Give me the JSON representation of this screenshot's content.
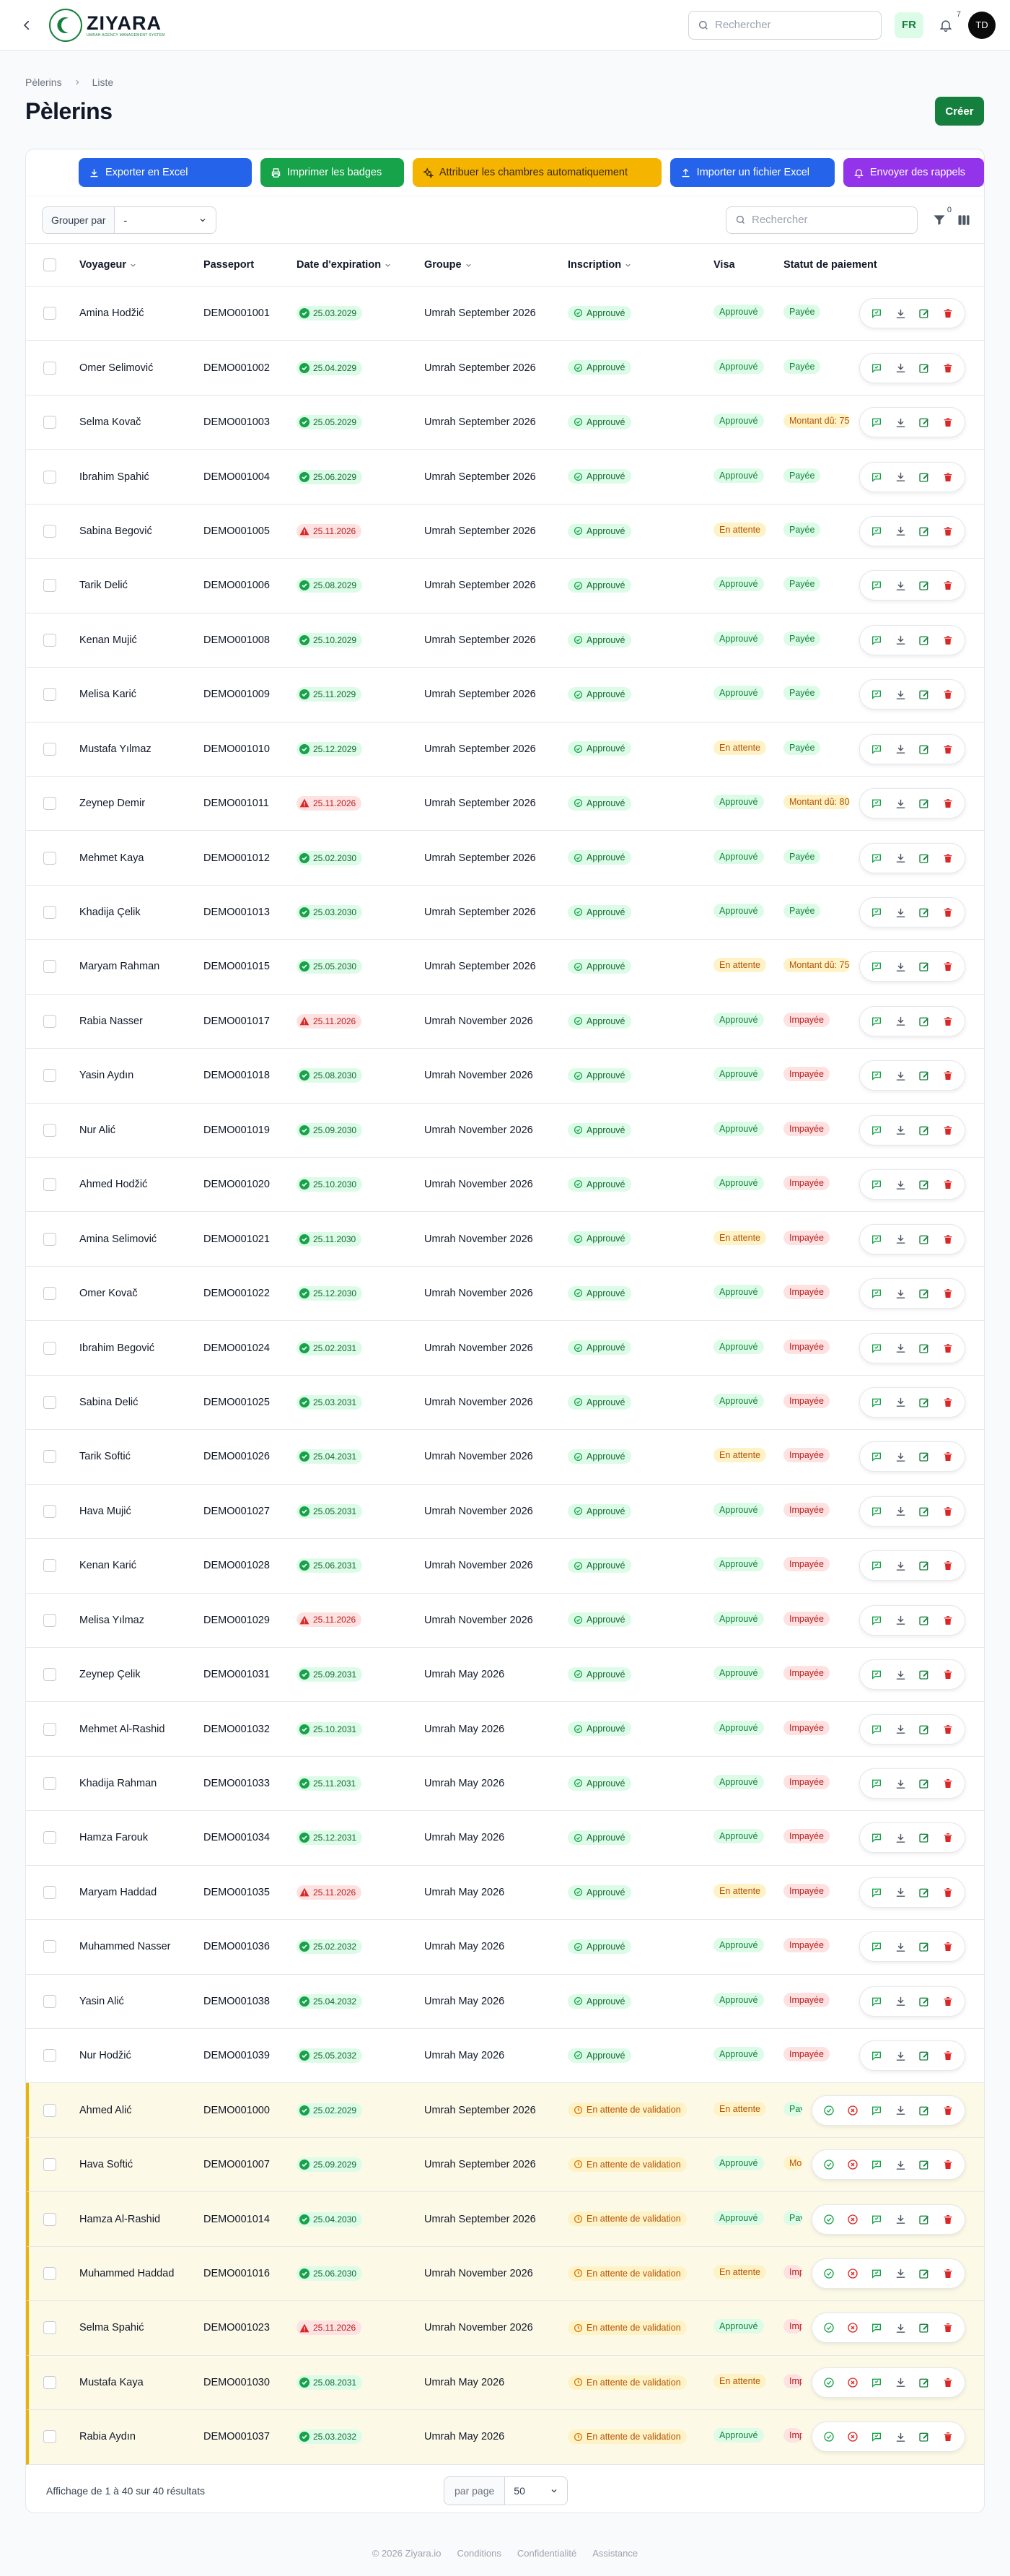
{
  "header": {
    "brand": "ZIYARA",
    "brand_sub": "UMRAH AGENCY MANAGEMENT SYSTEM",
    "search_placeholder": "Rechercher",
    "lang": "FR",
    "notifications": "7",
    "avatar": "TD"
  },
  "breadcrumb": {
    "home": "Pèlerins",
    "current": "Liste"
  },
  "page": {
    "title": "Pèlerins",
    "create_label": "Créer"
  },
  "actions": {
    "export": "Exporter en Excel",
    "print": "Imprimer les badges",
    "rooms": "Attribuer les chambres automatiquement",
    "import": "Importer un fichier Excel",
    "reminders": "Envoyer des rappels"
  },
  "filters": {
    "group_by_label": "Grouper par",
    "group_by_value": "-",
    "search_placeholder": "Rechercher",
    "filter_count": "0"
  },
  "columns": {
    "voyageur": "Voyageur",
    "passeport": "Passeport",
    "expiration": "Date d'expiration",
    "groupe": "Groupe",
    "inscription": "Inscription",
    "visa": "Visa",
    "paiement": "Statut de paiement"
  },
  "colors": {
    "brand": "#15803d",
    "pending_border": "#eab308"
  },
  "rows": [
    {
      "name": "Amina Hodžić",
      "passport": "DEMO001001",
      "exp": "25.03.2029",
      "exp_ok": true,
      "group": "Umrah September 2026",
      "ins": "Approuvé",
      "ins_ok": true,
      "visa": "Approuvé",
      "visa_ok": true,
      "pay": "Payée",
      "pay_type": "ok"
    },
    {
      "name": "Omer Selimović",
      "passport": "DEMO001002",
      "exp": "25.04.2029",
      "exp_ok": true,
      "group": "Umrah September 2026",
      "ins": "Approuvé",
      "ins_ok": true,
      "visa": "Approuvé",
      "visa_ok": true,
      "pay": "Payée",
      "pay_type": "ok"
    },
    {
      "name": "Selma Kovač",
      "passport": "DEMO001003",
      "exp": "25.05.2029",
      "exp_ok": true,
      "group": "Umrah September 2026",
      "ins": "Approuvé",
      "ins_ok": true,
      "visa": "Approuvé",
      "visa_ok": true,
      "pay": "Montant dû: 75",
      "pay_type": "due"
    },
    {
      "name": "Ibrahim Spahić",
      "passport": "DEMO001004",
      "exp": "25.06.2029",
      "exp_ok": true,
      "group": "Umrah September 2026",
      "ins": "Approuvé",
      "ins_ok": true,
      "visa": "Approuvé",
      "visa_ok": true,
      "pay": "Payée",
      "pay_type": "ok"
    },
    {
      "name": "Sabina Begović",
      "passport": "DEMO001005",
      "exp": "25.11.2026",
      "exp_ok": false,
      "group": "Umrah September 2026",
      "ins": "Approuvé",
      "ins_ok": true,
      "visa": "En attente",
      "visa_ok": false,
      "pay": "Payée",
      "pay_type": "ok"
    },
    {
      "name": "Tarik Delić",
      "passport": "DEMO001006",
      "exp": "25.08.2029",
      "exp_ok": true,
      "group": "Umrah September 2026",
      "ins": "Approuvé",
      "ins_ok": true,
      "visa": "Approuvé",
      "visa_ok": true,
      "pay": "Payée",
      "pay_type": "ok"
    },
    {
      "name": "Kenan Mujić",
      "passport": "DEMO001008",
      "exp": "25.10.2029",
      "exp_ok": true,
      "group": "Umrah September 2026",
      "ins": "Approuvé",
      "ins_ok": true,
      "visa": "Approuvé",
      "visa_ok": true,
      "pay": "Payée",
      "pay_type": "ok"
    },
    {
      "name": "Melisa Karić",
      "passport": "DEMO001009",
      "exp": "25.11.2029",
      "exp_ok": true,
      "group": "Umrah September 2026",
      "ins": "Approuvé",
      "ins_ok": true,
      "visa": "Approuvé",
      "visa_ok": true,
      "pay": "Payée",
      "pay_type": "ok"
    },
    {
      "name": "Mustafa Yılmaz",
      "passport": "DEMO001010",
      "exp": "25.12.2029",
      "exp_ok": true,
      "group": "Umrah September 2026",
      "ins": "Approuvé",
      "ins_ok": true,
      "visa": "En attente",
      "visa_ok": false,
      "pay": "Payée",
      "pay_type": "ok"
    },
    {
      "name": "Zeynep Demir",
      "passport": "DEMO001011",
      "exp": "25.11.2026",
      "exp_ok": false,
      "group": "Umrah September 2026",
      "ins": "Approuvé",
      "ins_ok": true,
      "visa": "Approuvé",
      "visa_ok": true,
      "pay": "Montant dû: 80",
      "pay_type": "due"
    },
    {
      "name": "Mehmet Kaya",
      "passport": "DEMO001012",
      "exp": "25.02.2030",
      "exp_ok": true,
      "group": "Umrah September 2026",
      "ins": "Approuvé",
      "ins_ok": true,
      "visa": "Approuvé",
      "visa_ok": true,
      "pay": "Payée",
      "pay_type": "ok"
    },
    {
      "name": "Khadija Çelik",
      "passport": "DEMO001013",
      "exp": "25.03.2030",
      "exp_ok": true,
      "group": "Umrah September 2026",
      "ins": "Approuvé",
      "ins_ok": true,
      "visa": "Approuvé",
      "visa_ok": true,
      "pay": "Payée",
      "pay_type": "ok"
    },
    {
      "name": "Maryam Rahman",
      "passport": "DEMO001015",
      "exp": "25.05.2030",
      "exp_ok": true,
      "group": "Umrah September 2026",
      "ins": "Approuvé",
      "ins_ok": true,
      "visa": "En attente",
      "visa_ok": false,
      "pay": "Montant dû: 75",
      "pay_type": "due"
    },
    {
      "name": "Rabia Nasser",
      "passport": "DEMO001017",
      "exp": "25.11.2026",
      "exp_ok": false,
      "group": "Umrah November 2026",
      "ins": "Approuvé",
      "ins_ok": true,
      "visa": "Approuvé",
      "visa_ok": true,
      "pay": "Impayée",
      "pay_type": "un"
    },
    {
      "name": "Yasin Aydın",
      "passport": "DEMO001018",
      "exp": "25.08.2030",
      "exp_ok": true,
      "group": "Umrah November 2026",
      "ins": "Approuvé",
      "ins_ok": true,
      "visa": "Approuvé",
      "visa_ok": true,
      "pay": "Impayée",
      "pay_type": "un"
    },
    {
      "name": "Nur Alić",
      "passport": "DEMO001019",
      "exp": "25.09.2030",
      "exp_ok": true,
      "group": "Umrah November 2026",
      "ins": "Approuvé",
      "ins_ok": true,
      "visa": "Approuvé",
      "visa_ok": true,
      "pay": "Impayée",
      "pay_type": "un"
    },
    {
      "name": "Ahmed Hodžić",
      "passport": "DEMO001020",
      "exp": "25.10.2030",
      "exp_ok": true,
      "group": "Umrah November 2026",
      "ins": "Approuvé",
      "ins_ok": true,
      "visa": "Approuvé",
      "visa_ok": true,
      "pay": "Impayée",
      "pay_type": "un"
    },
    {
      "name": "Amina Selimović",
      "passport": "DEMO001021",
      "exp": "25.11.2030",
      "exp_ok": true,
      "group": "Umrah November 2026",
      "ins": "Approuvé",
      "ins_ok": true,
      "visa": "En attente",
      "visa_ok": false,
      "pay": "Impayée",
      "pay_type": "un"
    },
    {
      "name": "Omer Kovač",
      "passport": "DEMO001022",
      "exp": "25.12.2030",
      "exp_ok": true,
      "group": "Umrah November 2026",
      "ins": "Approuvé",
      "ins_ok": true,
      "visa": "Approuvé",
      "visa_ok": true,
      "pay": "Impayée",
      "pay_type": "un"
    },
    {
      "name": "Ibrahim Begović",
      "passport": "DEMO001024",
      "exp": "25.02.2031",
      "exp_ok": true,
      "group": "Umrah November 2026",
      "ins": "Approuvé",
      "ins_ok": true,
      "visa": "Approuvé",
      "visa_ok": true,
      "pay": "Impayée",
      "pay_type": "un"
    },
    {
      "name": "Sabina Delić",
      "passport": "DEMO001025",
      "exp": "25.03.2031",
      "exp_ok": true,
      "group": "Umrah November 2026",
      "ins": "Approuvé",
      "ins_ok": true,
      "visa": "Approuvé",
      "visa_ok": true,
      "pay": "Impayée",
      "pay_type": "un"
    },
    {
      "name": "Tarik Softić",
      "passport": "DEMO001026",
      "exp": "25.04.2031",
      "exp_ok": true,
      "group": "Umrah November 2026",
      "ins": "Approuvé",
      "ins_ok": true,
      "visa": "En attente",
      "visa_ok": false,
      "pay": "Impayée",
      "pay_type": "un"
    },
    {
      "name": "Hava Mujić",
      "passport": "DEMO001027",
      "exp": "25.05.2031",
      "exp_ok": true,
      "group": "Umrah November 2026",
      "ins": "Approuvé",
      "ins_ok": true,
      "visa": "Approuvé",
      "visa_ok": true,
      "pay": "Impayée",
      "pay_type": "un"
    },
    {
      "name": "Kenan Karić",
      "passport": "DEMO001028",
      "exp": "25.06.2031",
      "exp_ok": true,
      "group": "Umrah November 2026",
      "ins": "Approuvé",
      "ins_ok": true,
      "visa": "Approuvé",
      "visa_ok": true,
      "pay": "Impayée",
      "pay_type": "un"
    },
    {
      "name": "Melisa Yılmaz",
      "passport": "DEMO001029",
      "exp": "25.11.2026",
      "exp_ok": false,
      "group": "Umrah November 2026",
      "ins": "Approuvé",
      "ins_ok": true,
      "visa": "Approuvé",
      "visa_ok": true,
      "pay": "Impayée",
      "pay_type": "un"
    },
    {
      "name": "Zeynep Çelik",
      "passport": "DEMO001031",
      "exp": "25.09.2031",
      "exp_ok": true,
      "group": "Umrah May 2026",
      "ins": "Approuvé",
      "ins_ok": true,
      "visa": "Approuvé",
      "visa_ok": true,
      "pay": "Impayée",
      "pay_type": "un"
    },
    {
      "name": "Mehmet Al-Rashid",
      "passport": "DEMO001032",
      "exp": "25.10.2031",
      "exp_ok": true,
      "group": "Umrah May 2026",
      "ins": "Approuvé",
      "ins_ok": true,
      "visa": "Approuvé",
      "visa_ok": true,
      "pay": "Impayée",
      "pay_type": "un"
    },
    {
      "name": "Khadija Rahman",
      "passport": "DEMO001033",
      "exp": "25.11.2031",
      "exp_ok": true,
      "group": "Umrah May 2026",
      "ins": "Approuvé",
      "ins_ok": true,
      "visa": "Approuvé",
      "visa_ok": true,
      "pay": "Impayée",
      "pay_type": "un"
    },
    {
      "name": "Hamza Farouk",
      "passport": "DEMO001034",
      "exp": "25.12.2031",
      "exp_ok": true,
      "group": "Umrah May 2026",
      "ins": "Approuvé",
      "ins_ok": true,
      "visa": "Approuvé",
      "visa_ok": true,
      "pay": "Impayée",
      "pay_type": "un"
    },
    {
      "name": "Maryam Haddad",
      "passport": "DEMO001035",
      "exp": "25.11.2026",
      "exp_ok": false,
      "group": "Umrah May 2026",
      "ins": "Approuvé",
      "ins_ok": true,
      "visa": "En attente",
      "visa_ok": false,
      "pay": "Impayée",
      "pay_type": "un"
    },
    {
      "name": "Muhammed Nasser",
      "passport": "DEMO001036",
      "exp": "25.02.2032",
      "exp_ok": true,
      "group": "Umrah May 2026",
      "ins": "Approuvé",
      "ins_ok": true,
      "visa": "Approuvé",
      "visa_ok": true,
      "pay": "Impayée",
      "pay_type": "un"
    },
    {
      "name": "Yasin Alić",
      "passport": "DEMO001038",
      "exp": "25.04.2032",
      "exp_ok": true,
      "group": "Umrah May 2026",
      "ins": "Approuvé",
      "ins_ok": true,
      "visa": "Approuvé",
      "visa_ok": true,
      "pay": "Impayée",
      "pay_type": "un"
    },
    {
      "name": "Nur Hodžić",
      "passport": "DEMO001039",
      "exp": "25.05.2032",
      "exp_ok": true,
      "group": "Umrah May 2026",
      "ins": "Approuvé",
      "ins_ok": true,
      "visa": "Approuvé",
      "visa_ok": true,
      "pay": "Impayée",
      "pay_type": "un"
    },
    {
      "name": "Ahmed Alić",
      "passport": "DEMO001000",
      "exp": "25.02.2029",
      "exp_ok": true,
      "group": "Umrah September 2026",
      "ins": "En attente de validation",
      "ins_ok": false,
      "visa": "En attente",
      "visa_ok": false,
      "pay": "Payée",
      "pay_type": "ok",
      "pending": true
    },
    {
      "name": "Hava Softić",
      "passport": "DEMO001007",
      "exp": "25.09.2029",
      "exp_ok": true,
      "group": "Umrah September 2026",
      "ins": "En attente de validation",
      "ins_ok": false,
      "visa": "Approuvé",
      "visa_ok": true,
      "pay": "Montant dû",
      "pay_type": "due",
      "pending": true
    },
    {
      "name": "Hamza Al-Rashid",
      "passport": "DEMO001014",
      "exp": "25.04.2030",
      "exp_ok": true,
      "group": "Umrah September 2026",
      "ins": "En attente de validation",
      "ins_ok": false,
      "visa": "Approuvé",
      "visa_ok": true,
      "pay": "Payée",
      "pay_type": "ok",
      "pending": true
    },
    {
      "name": "Muhammed Haddad",
      "passport": "DEMO001016",
      "exp": "25.06.2030",
      "exp_ok": true,
      "group": "Umrah November 2026",
      "ins": "En attente de validation",
      "ins_ok": false,
      "visa": "En attente",
      "visa_ok": false,
      "pay": "Impayée",
      "pay_type": "un",
      "pending": true
    },
    {
      "name": "Selma Spahić",
      "passport": "DEMO001023",
      "exp": "25.11.2026",
      "exp_ok": false,
      "group": "Umrah November 2026",
      "ins": "En attente de validation",
      "ins_ok": false,
      "visa": "Approuvé",
      "visa_ok": true,
      "pay": "Impayée",
      "pay_type": "un",
      "pending": true
    },
    {
      "name": "Mustafa Kaya",
      "passport": "DEMO001030",
      "exp": "25.08.2031",
      "exp_ok": true,
      "group": "Umrah May 2026",
      "ins": "En attente de validation",
      "ins_ok": false,
      "visa": "En attente",
      "visa_ok": false,
      "pay": "Impayée",
      "pay_type": "un",
      "pending": true
    },
    {
      "name": "Rabia Aydın",
      "passport": "DEMO001037",
      "exp": "25.03.2032",
      "exp_ok": true,
      "group": "Umrah May 2026",
      "ins": "En attente de validation",
      "ins_ok": false,
      "visa": "Approuvé",
      "visa_ok": true,
      "pay": "Impayée",
      "pay_type": "un",
      "pending": true
    }
  ],
  "pagination": {
    "summary": "Affichage de 1 à 40 sur 40 résultats",
    "per_page_label": "par page",
    "per_page_value": "50"
  },
  "footer": {
    "copyright": "© 2026 Ziyara.io",
    "terms": "Conditions",
    "privacy": "Confidentialité",
    "support": "Assistance"
  }
}
